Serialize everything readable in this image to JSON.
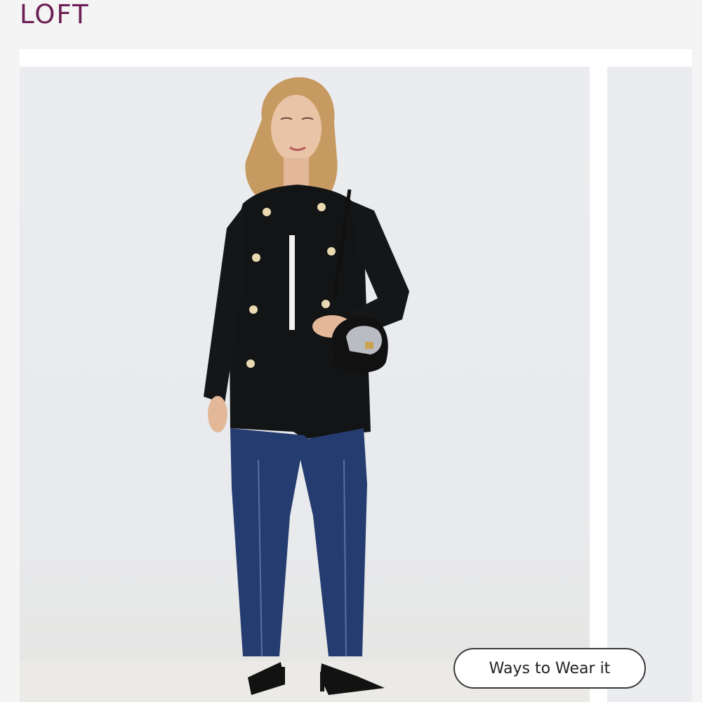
{
  "brand": {
    "logo_text": "LOFT",
    "logo_color": "#6c1f55"
  },
  "gallery": {
    "main_image_icon": "model-photo",
    "ways_to_wear_label": "Ways to Wear it"
  },
  "colors": {
    "coat": "#131415",
    "denim": "#253c70",
    "background": "#eaecef"
  }
}
